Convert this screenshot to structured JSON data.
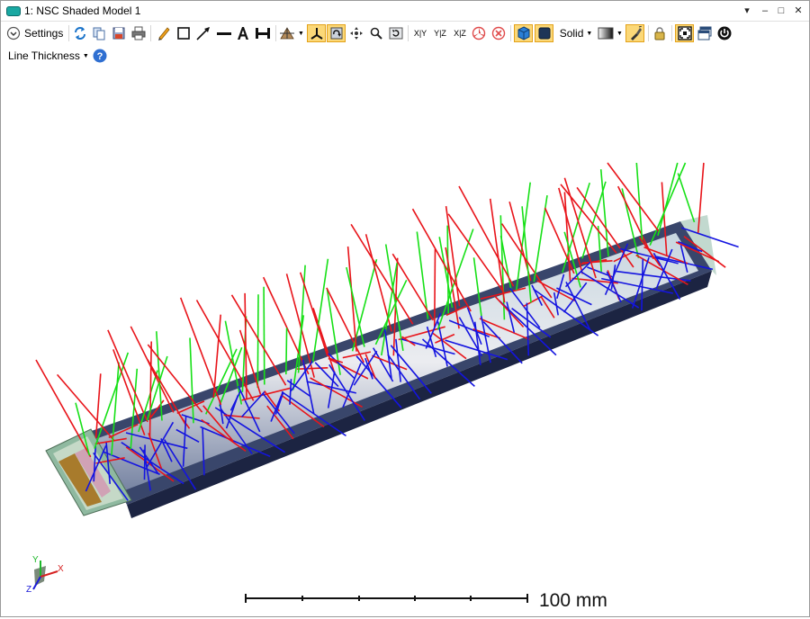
{
  "window": {
    "title": "1: NSC Shaded Model 1",
    "controls": [
      "▾",
      "–",
      "□",
      "✕"
    ]
  },
  "toolbar": {
    "settings_label": "Settings",
    "axis_labels": {
      "xy": "X|Y",
      "yz": "Y|Z",
      "xz": "X|Z"
    },
    "render_mode": "Solid",
    "line_thickness_label": "Line Thickness"
  },
  "viewport": {
    "scale_label": "100 mm",
    "triad": {
      "x": "X",
      "y": "Y",
      "z": "Z"
    },
    "colors": {
      "red": "#e8141a",
      "green": "#16e016",
      "blue": "#1414e0"
    }
  }
}
